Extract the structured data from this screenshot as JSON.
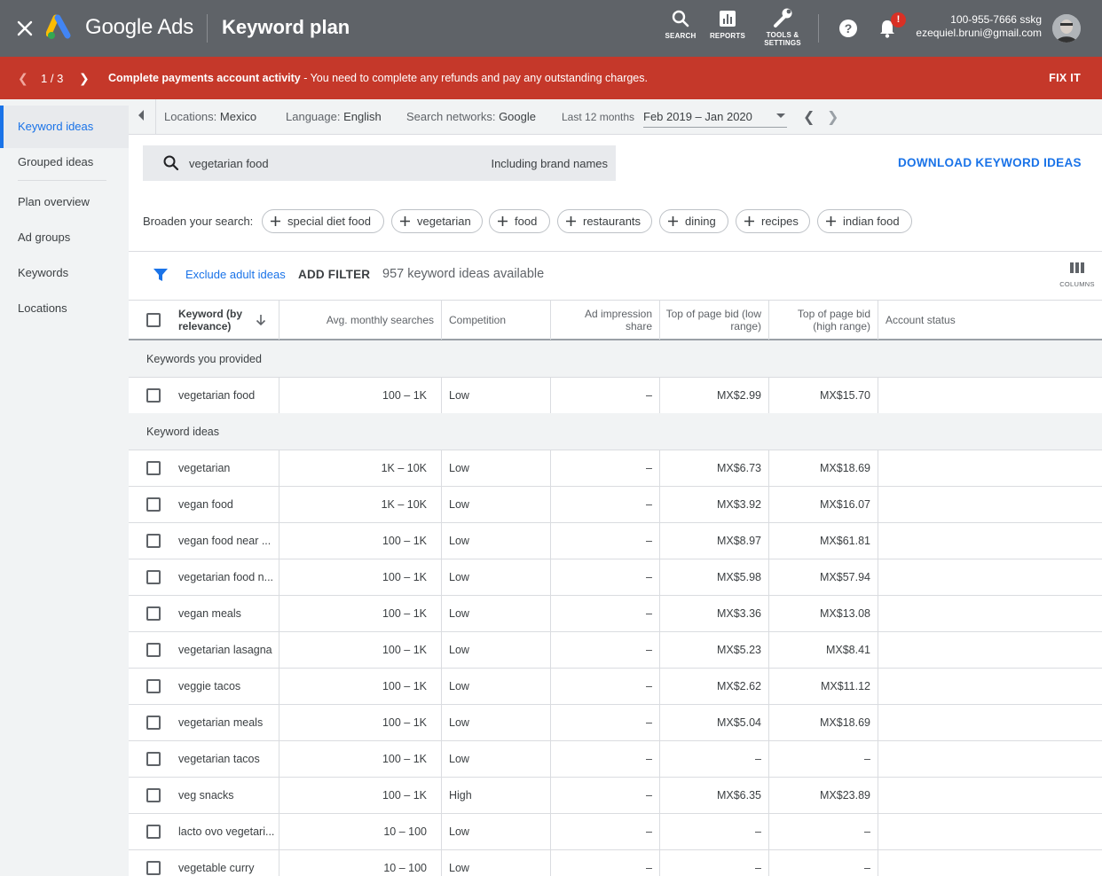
{
  "header": {
    "brand": "Google Ads",
    "title": "Keyword plan",
    "tools": [
      {
        "label": "SEARCH",
        "icon": "search-icon"
      },
      {
        "label": "REPORTS",
        "icon": "reports-icon"
      },
      {
        "label": "TOOLS &",
        "label2": "SETTINGS",
        "icon": "wrench-icon"
      }
    ],
    "notification_badge": "!",
    "account_id": "100-955-7666 sskg",
    "account_email": "ezequiel.bruni@gmail.com"
  },
  "alert": {
    "pager": "1 / 3",
    "title": "Complete payments account activity",
    "message": " - You need to complete any refunds and pay any outstanding charges.",
    "action": "FIX IT",
    "color": "#c5382a"
  },
  "sidebar": {
    "items": [
      {
        "label": "Keyword ideas",
        "active": true
      },
      {
        "label": "Grouped ideas"
      },
      {
        "label": "Plan overview"
      },
      {
        "label": "Ad groups"
      },
      {
        "label": "Keywords"
      },
      {
        "label": "Locations"
      }
    ]
  },
  "filters": {
    "locations_label": "Locations:",
    "locations_value": "Mexico",
    "language_label": "Language:",
    "language_value": "English",
    "networks_label": "Search networks:",
    "networks_value": "Google",
    "range_label": "Last 12 months",
    "range_value": "Feb 2019 – Jan 2020"
  },
  "search": {
    "query": "vegetarian food",
    "brand_toggle": "Including brand names",
    "download": "DOWNLOAD KEYWORD IDEAS"
  },
  "broaden": {
    "label": "Broaden your search:",
    "chips": [
      "special diet food",
      "vegetarian",
      "food",
      "restaurants",
      "dining",
      "recipes",
      "indian food"
    ]
  },
  "toolbar": {
    "exclude": "Exclude adult ideas",
    "add_filter": "ADD FILTER",
    "count": "957 keyword ideas available",
    "columns": "COLUMNS"
  },
  "table": {
    "headers": {
      "keyword": "Keyword (by relevance)",
      "searches": "Avg. monthly searches",
      "competition": "Competition",
      "impression": "Ad impression share",
      "bid_low": "Top of page bid (low range)",
      "bid_high": "Top of page bid (high range)",
      "status": "Account status"
    },
    "group_provided": "Keywords you provided",
    "group_ideas": "Keyword ideas",
    "provided": [
      {
        "keyword": "vegetarian food",
        "searches": "100 – 1K",
        "competition": "Low",
        "impression": "–",
        "low": "MX$2.99",
        "high": "MX$15.70"
      }
    ],
    "ideas": [
      {
        "keyword": "vegetarian",
        "searches": "1K – 10K",
        "competition": "Low",
        "impression": "–",
        "low": "MX$6.73",
        "high": "MX$18.69"
      },
      {
        "keyword": "vegan food",
        "searches": "1K – 10K",
        "competition": "Low",
        "impression": "–",
        "low": "MX$3.92",
        "high": "MX$16.07"
      },
      {
        "keyword": "vegan food near ...",
        "searches": "100 – 1K",
        "competition": "Low",
        "impression": "–",
        "low": "MX$8.97",
        "high": "MX$61.81"
      },
      {
        "keyword": "vegetarian food n...",
        "searches": "100 – 1K",
        "competition": "Low",
        "impression": "–",
        "low": "MX$5.98",
        "high": "MX$57.94"
      },
      {
        "keyword": "vegan meals",
        "searches": "100 – 1K",
        "competition": "Low",
        "impression": "–",
        "low": "MX$3.36",
        "high": "MX$13.08"
      },
      {
        "keyword": "vegetarian lasagna",
        "searches": "100 – 1K",
        "competition": "Low",
        "impression": "–",
        "low": "MX$5.23",
        "high": "MX$8.41"
      },
      {
        "keyword": "veggie tacos",
        "searches": "100 – 1K",
        "competition": "Low",
        "impression": "–",
        "low": "MX$2.62",
        "high": "MX$11.12"
      },
      {
        "keyword": "vegetarian meals",
        "searches": "100 – 1K",
        "competition": "Low",
        "impression": "–",
        "low": "MX$5.04",
        "high": "MX$18.69"
      },
      {
        "keyword": "vegetarian tacos",
        "searches": "100 – 1K",
        "competition": "Low",
        "impression": "–",
        "low": "–",
        "high": "–"
      },
      {
        "keyword": "veg snacks",
        "searches": "100 – 1K",
        "competition": "High",
        "impression": "–",
        "low": "MX$6.35",
        "high": "MX$23.89"
      },
      {
        "keyword": "lacto ovo vegetari...",
        "searches": "10 – 100",
        "competition": "Low",
        "impression": "–",
        "low": "–",
        "high": "–"
      },
      {
        "keyword": "vegetable curry",
        "searches": "10 – 100",
        "competition": "Low",
        "impression": "–",
        "low": "–",
        "high": "–"
      }
    ]
  }
}
